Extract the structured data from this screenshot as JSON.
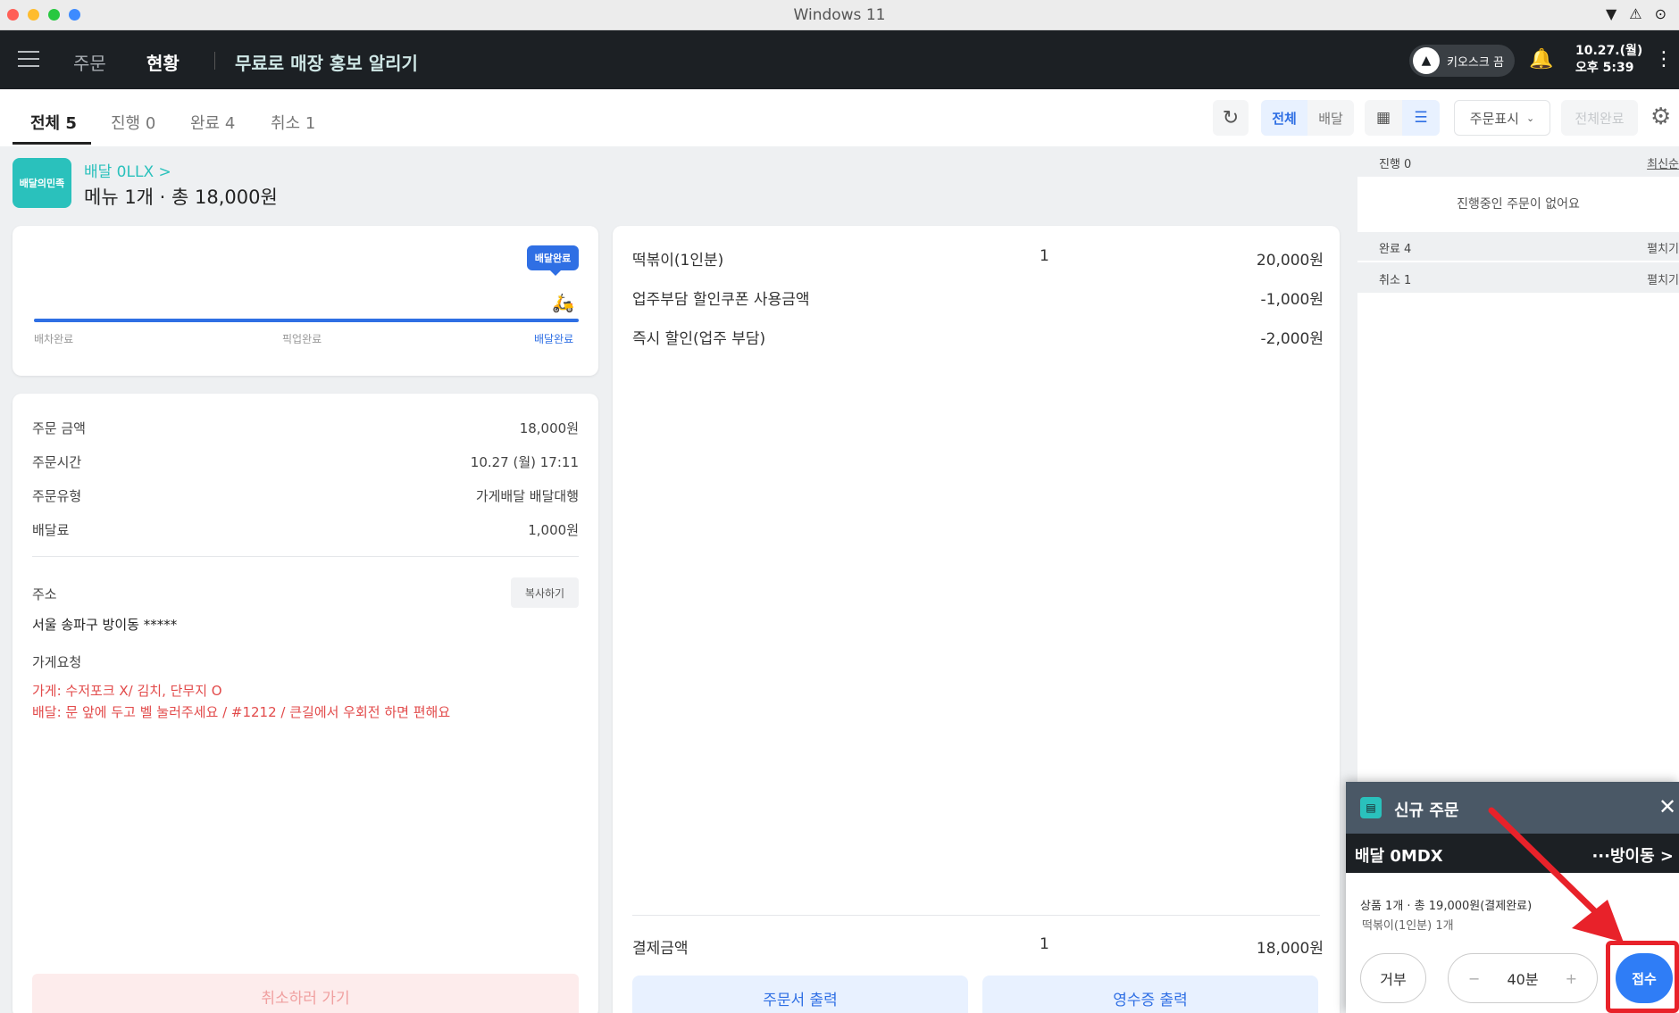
{
  "window": {
    "title": "Windows 11",
    "status_icons": [
      "▼",
      "⚠",
      "⊙"
    ]
  },
  "header": {
    "nav_order": "주문",
    "nav_status": "현황",
    "promo": "무료로 매장 홍보 알리기",
    "kiosk_label": "키오스크 끔",
    "date": "10.27.(월)",
    "time": "오후 5:39"
  },
  "tabs": [
    {
      "label": "전체 5"
    },
    {
      "label": "진행 0"
    },
    {
      "label": "완료 4"
    },
    {
      "label": "취소 1"
    }
  ],
  "toolbar": {
    "filter_all": "전체",
    "filter_delivery": "배달",
    "order_display": "주문표시",
    "complete_all": "전체완료"
  },
  "order": {
    "store_icon_text": "배달의민족",
    "id_link": "배달 0LLX >",
    "summary": "메뉴 1개 · 총 18,000원",
    "progress_badge": "배달완료",
    "steps": [
      "배차완료",
      "픽업완료",
      "배달완료"
    ],
    "info": [
      {
        "label": "주문 금액",
        "value": "18,000원"
      },
      {
        "label": "주문시간",
        "value": "10.27 (월) 17:11"
      },
      {
        "label": "주문유형",
        "value": "가게배달 배달대행"
      },
      {
        "label": "배달료",
        "value": "1,000원"
      }
    ],
    "address_label": "주소",
    "copy_button": "복사하기",
    "address": "서울 송파구 방이동 *****",
    "request_label": "가게요청",
    "store_request": "가게:  수저포크 X/ 김치, 단무지 O",
    "delivery_request": "배달: 문 앞에 두고 벨 눌러주세요 / #1212  / 큰길에서 우회전 하면 편해요",
    "cancel_button": "취소하러 가기",
    "items": [
      {
        "name": "떡볶이(1인분)",
        "qty": "1",
        "price": "20,000원",
        "discount": false
      },
      {
        "name": "업주부담 할인쿠폰 사용금액",
        "qty": "",
        "price": "-1,000원",
        "discount": true
      },
      {
        "name": "즉시 할인(업주 부담)",
        "qty": "",
        "price": "-2,000원",
        "discount": true
      }
    ],
    "payment_label": "결제금액",
    "payment_qty": "1",
    "payment_total": "18,000원",
    "print_order": "주문서 출력",
    "print_receipt": "영수증 출력"
  },
  "side_panel": {
    "in_progress": "진행 0",
    "sort_label": "최신순",
    "empty_message": "진행중인 주문이 없어요",
    "completed": "완료 4",
    "canceled": "취소 1",
    "expand_label": "펼치기"
  },
  "new_order_popup": {
    "title": "신규 주문",
    "order_id": "배달 0MDX",
    "address": "···방이동 >",
    "line1": "상품 1개 · 총 19,000원(결제완료)",
    "line2": "떡볶이(1인분) 1개",
    "reject": "거부",
    "minus": "−",
    "time": "40분",
    "plus": "+",
    "accept": "접수"
  },
  "colors": {
    "accent": "#2f6fe4",
    "brand": "#2ac1bc",
    "highlight": "#e8222a",
    "discount": "#e24a4a"
  }
}
